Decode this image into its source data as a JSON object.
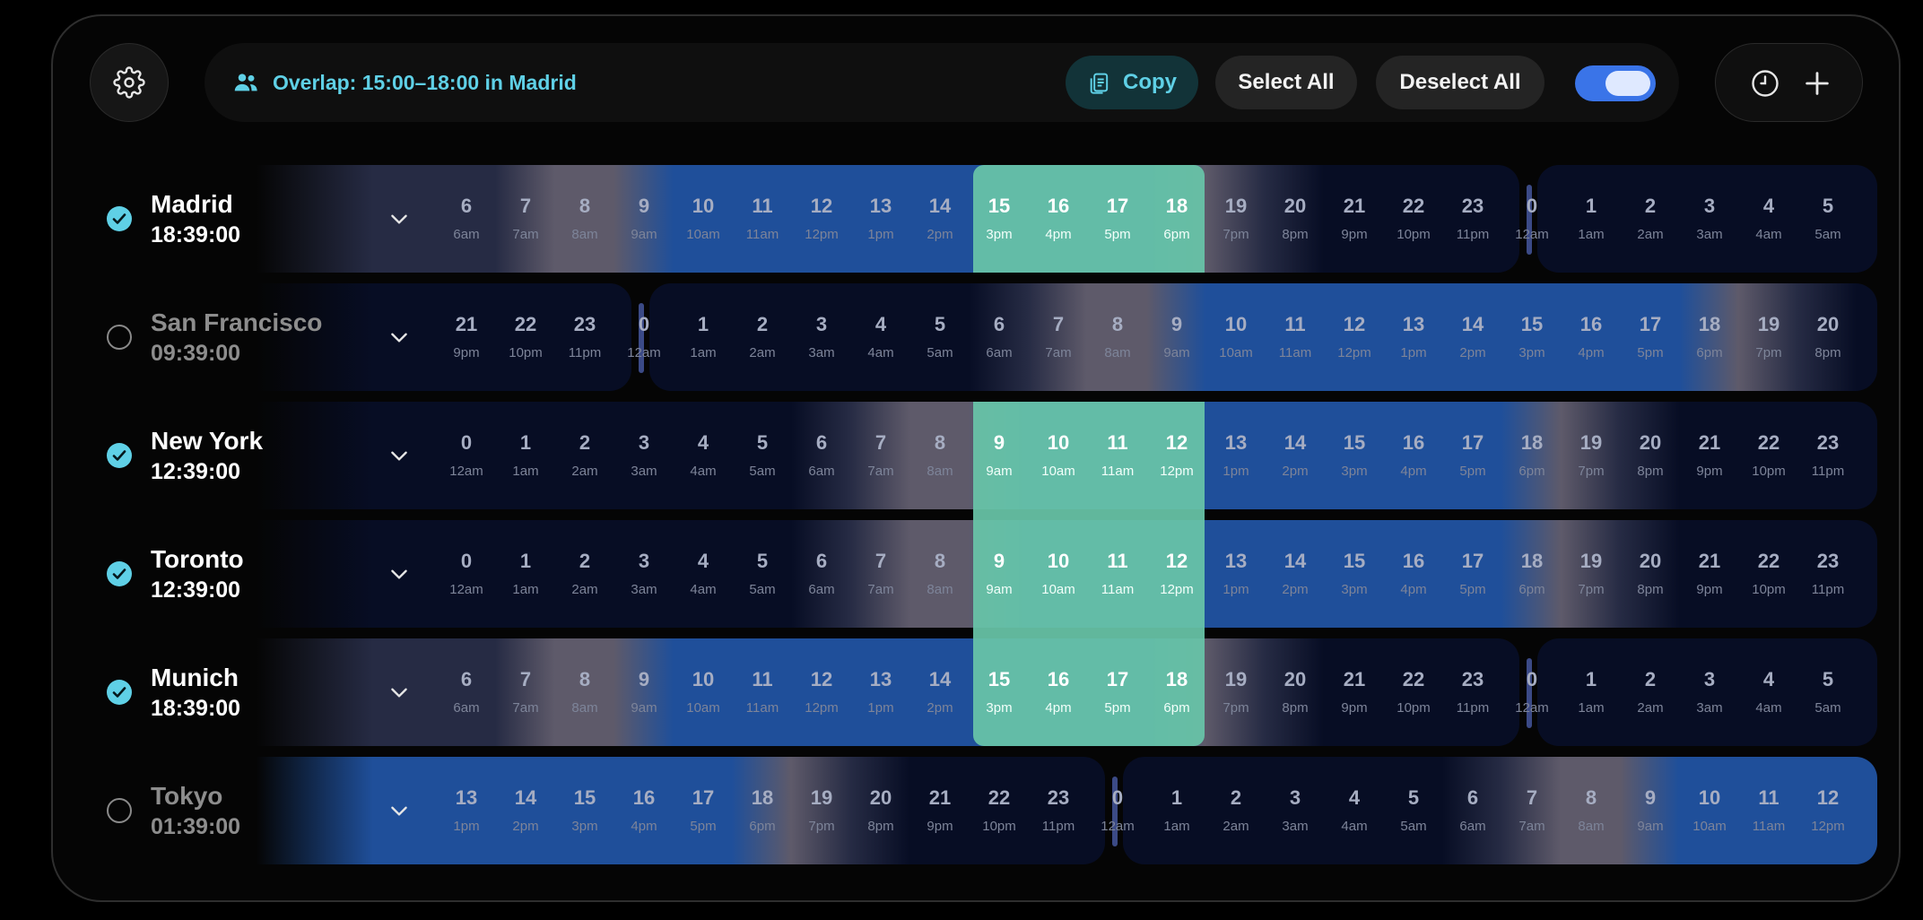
{
  "toolbar": {
    "overlap_text": "Overlap: 15:00–18:00 in Madrid",
    "copy_label": "Copy",
    "select_all_label": "Select All",
    "deselect_all_label": "Deselect All",
    "toggle_on": true
  },
  "colors": {
    "accent": "#5fd0e6",
    "highlight": "#68c5a8",
    "toggle": "#3a74e8",
    "day_blue": "#1f4f9a",
    "night": "#070d24"
  },
  "rows": [
    {
      "city": "Madrid",
      "time": "18:39:00",
      "selected": true,
      "start": 6
    },
    {
      "city": "San Francisco",
      "time": "09:39:00",
      "selected": false,
      "start": 21
    },
    {
      "city": "New York",
      "time": "12:39:00",
      "selected": true,
      "start": 0
    },
    {
      "city": "Toronto",
      "time": "12:39:00",
      "selected": true,
      "start": 0
    },
    {
      "city": "Munich",
      "time": "18:39:00",
      "selected": true,
      "start": 6
    },
    {
      "city": "Tokyo",
      "time": "01:39:00",
      "selected": false,
      "start": 13
    }
  ],
  "overlap_columns": [
    9,
    10,
    11,
    12
  ]
}
